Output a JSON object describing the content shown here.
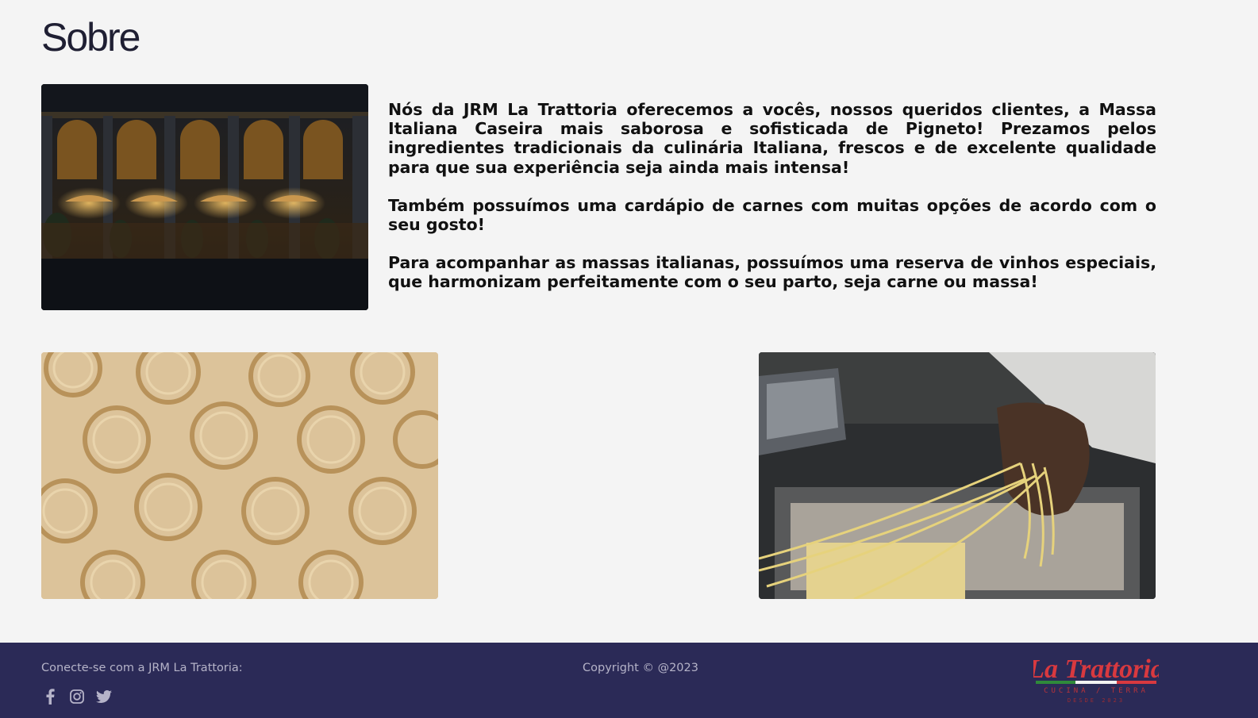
{
  "page": {
    "title": "Sobre"
  },
  "about": {
    "paragraphs": [
      "Nós da JRM La Trattoria oferecemos a vocês, nossos queridos clientes, a Massa Italiana Caseira mais saborosa e sofisticada de Pigneto! Prezamos pelos ingredientes tradicionais da culinária Italiana, frescos e de excelente qualidade para que sua experiência seja ainda mais intensa!",
      "Também possuímos uma cardápio de carnes com muitas opções de acordo com o seu gosto!",
      "Para acompanhar as massas italianas, possuímos uma reserva de vinhos especiais, que harmonizam perfeitamente com o seu parto, seja carne ou massa!"
    ]
  },
  "footer": {
    "connect_label": "Conecte-se com a JRM La Trattoria:",
    "copyright": "Copyright © @2023",
    "social_icons": [
      "facebook-icon",
      "instagram-icon",
      "twitter-icon"
    ],
    "logo": {
      "text": "La Trattoria",
      "subtitle": "CUCINA / TERRA",
      "tagline": "DESDE 2023"
    }
  },
  "colors": {
    "background": "#f4f4f4",
    "footer_bg": "#2b2a57",
    "footer_text": "#b5b3c8",
    "logo_red": "#d8393f",
    "text": "#111111"
  }
}
